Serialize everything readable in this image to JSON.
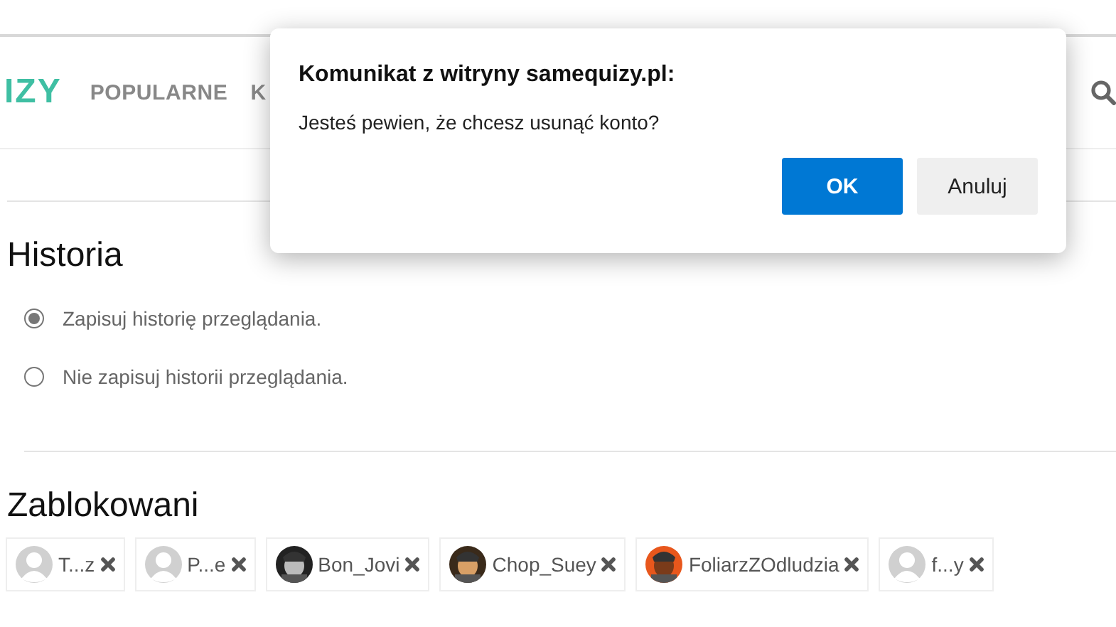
{
  "header": {
    "logo": "IZY",
    "nav": [
      "POPULARNE",
      "K"
    ]
  },
  "dialog": {
    "title": "Komunikat z witryny samequizy.pl:",
    "message": "Jesteś pewien, że chcesz usunąć konto?",
    "buttons": [
      {
        "label": "OK",
        "kind": "primary"
      },
      {
        "label": "Anuluj",
        "kind": "secondary"
      }
    ]
  },
  "history": {
    "title": "Historia",
    "options": [
      {
        "label": "Zapisuj historię przeglądania.",
        "selected": true
      },
      {
        "label": "Nie zapisuj historii przeglądania.",
        "selected": false
      }
    ]
  },
  "blocked": {
    "title": "Zablokowani",
    "users": [
      {
        "name": "T...z",
        "kind": "default"
      },
      {
        "name": "P...e",
        "kind": "default"
      },
      {
        "name": "Bon_Jovi"
      },
      {
        "name": "Chop_Suey"
      },
      {
        "name": "FoliarzZOdludzia"
      },
      {
        "name": "f...y",
        "kind": "default"
      }
    ]
  }
}
